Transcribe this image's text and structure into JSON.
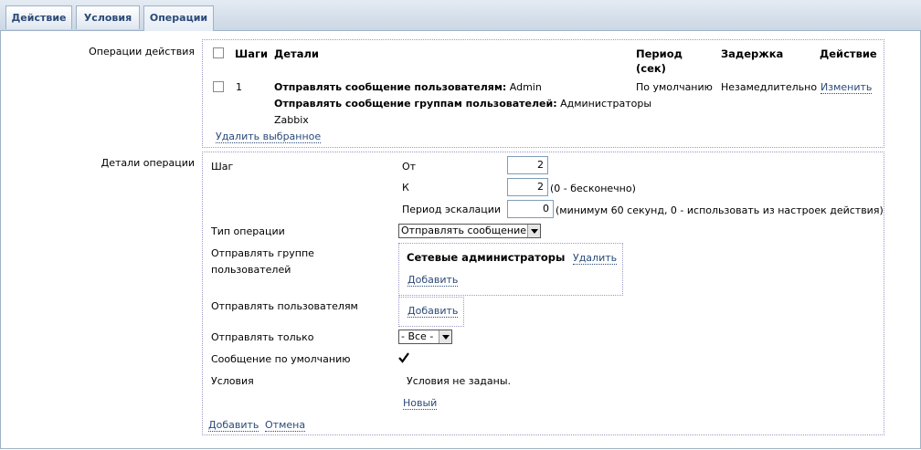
{
  "tabs": [
    {
      "label": "Действие"
    },
    {
      "label": "Условия"
    },
    {
      "label": "Операции"
    }
  ],
  "action_operations": {
    "label": "Операции действия",
    "headers": {
      "steps": "Шаги",
      "details": "Детали",
      "period_line1": "Период",
      "period_line2": "(сек)",
      "delay": "Задержка",
      "action": "Действие"
    },
    "rows": [
      {
        "step": "1",
        "detail1_bold": "Отправлять сообщение пользователям:",
        "detail1_value": "Admin",
        "detail2_bold": "Отправлять сообщение группам пользователей:",
        "detail2_value": "Администраторы",
        "detail2_wrap": "Zabbix",
        "period": "По умолчанию",
        "delay": "Незамедлительно",
        "action_link": "Изменить"
      }
    ],
    "delete_selected": "Удалить выбранное"
  },
  "operation_details": {
    "label": "Детали операции",
    "step_label": "Шаг",
    "from_label": "От",
    "from_value": "2",
    "to_label": "К",
    "to_value": "2",
    "to_hint": "(0 - бесконечно)",
    "escalation_label": "Период эскалации",
    "escalation_value": "0",
    "escalation_hint": "(минимум 60 секунд, 0 - использовать из настроек действия)",
    "op_type_label": "Тип операции",
    "op_type_value": "Отправлять сообщение",
    "send_group_label_line1": "Отправлять группе",
    "send_group_label_line2": "пользователей",
    "group_name": "Сетевые администраторы",
    "group_delete": "Удалить",
    "group_add": "Добавить",
    "send_users_label": "Отправлять пользователям",
    "users_add": "Добавить",
    "send_only_label": "Отправлять только",
    "send_only_value": "- Все -",
    "default_msg_label": "Сообщение по умолчанию",
    "default_msg_checked": true,
    "conditions_label": "Условия",
    "conditions_empty": "Условия не заданы.",
    "conditions_new": "Новый",
    "add_link": "Добавить",
    "cancel_link": "Отмена"
  },
  "colors": {
    "link": "#2b4a78",
    "tab_border": "#9fb2c7",
    "box_border": "#9a9ac8"
  }
}
